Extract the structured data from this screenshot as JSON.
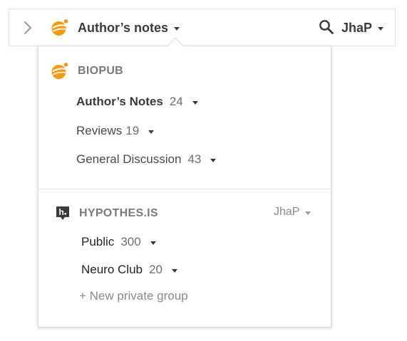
{
  "topbar": {
    "group_title": "Author’s notes",
    "user_name": "JhaP"
  },
  "icons": {
    "sidebar_toggle": "chevron-right-icon",
    "group_logo": "orange-orb-icon",
    "search": "search-icon",
    "hypothesis": "hypothesis-logo-icon"
  },
  "colors": {
    "orb_orange": "#f39a19",
    "text_dark": "#3c3c3c",
    "text_muted": "#8a8a8a"
  },
  "biopub": {
    "name": "BIOPUB",
    "items": [
      {
        "label": "Author’s Notes",
        "count": "24"
      },
      {
        "label": "Reviews",
        "count": "19"
      },
      {
        "label": "General Discussion",
        "count": "43"
      }
    ]
  },
  "hypothesis": {
    "name": "HYPOTHES.IS",
    "account": "JhaP",
    "items": [
      {
        "label": "Public",
        "count": "300"
      },
      {
        "label": "Neuro Club",
        "count": "20"
      }
    ],
    "new_group": "+ New private group"
  }
}
